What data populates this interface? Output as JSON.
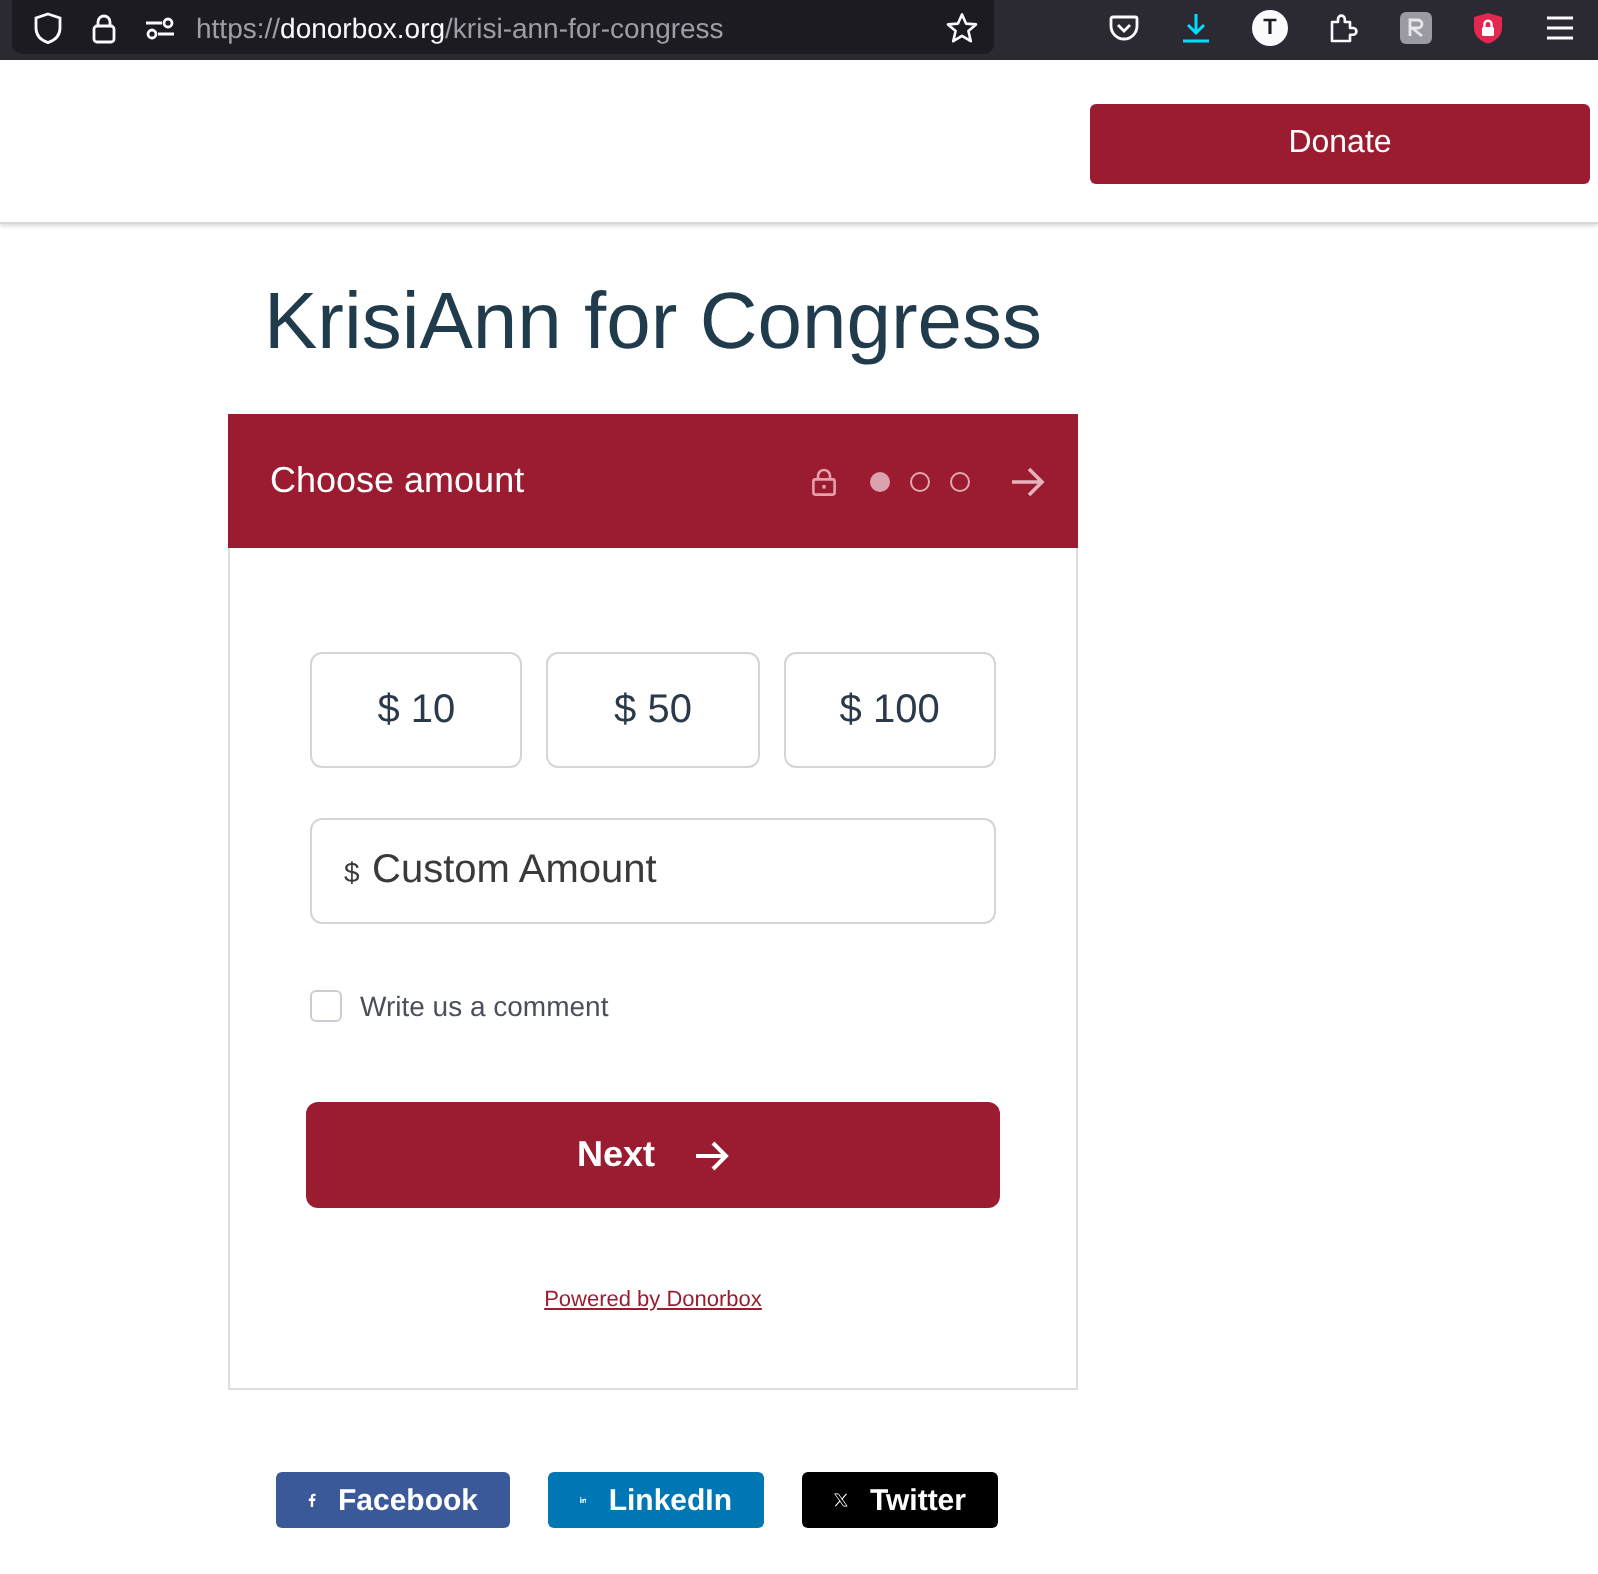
{
  "browser_toolbar": {
    "url": {
      "scheme": "https://",
      "host": "donorbox.org",
      "path": "/krisi-ann-for-congress"
    },
    "extension_badge": "T"
  },
  "header": {
    "donate_button": "Donate"
  },
  "page_title": "KrisiAnn for Congress",
  "donation_form": {
    "step_title": "Choose amount",
    "steps": [
      {
        "selected": true
      },
      {
        "selected": false
      },
      {
        "selected": false
      }
    ],
    "amounts": [
      {
        "label": "$ 10",
        "selected": false
      },
      {
        "label": "$ 50",
        "selected": false
      },
      {
        "label": "$ 100",
        "selected": false
      }
    ],
    "custom_amount": {
      "currency": "$",
      "placeholder": "Custom Amount"
    },
    "comment_option": {
      "label": "Write us a comment",
      "checked": false
    },
    "next_button": "Next",
    "powered_by": "Powered by Donorbox"
  },
  "share_buttons": [
    {
      "kind": "facebook",
      "label": "Facebook"
    },
    {
      "kind": "linkedin",
      "label": "LinkedIn"
    },
    {
      "kind": "twitter",
      "label": "Twitter"
    }
  ]
}
